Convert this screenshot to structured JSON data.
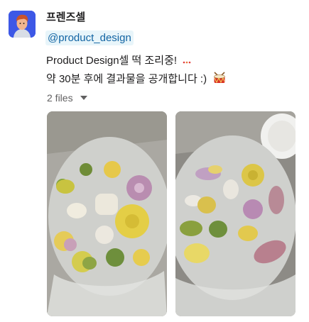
{
  "message": {
    "sender": "프렌즈셀",
    "mention": "@product_design",
    "line1": "Product Design셀 떡 조리중!",
    "line2": "약 30분 후에 결과물을 공개합니다 :)"
  },
  "attachments": {
    "files_label": "2 files",
    "count": 2
  },
  "icons": {
    "avatar": "avatar-person",
    "line1_emoji": "dots-emoji",
    "line2_emoji": "drum-emoji",
    "toggle": "caret-down-icon"
  },
  "colors": {
    "link": "#1264a3",
    "mention_bg": "#e8f5fa",
    "muted": "#616061",
    "avatar_bg": "#3d58e6"
  }
}
